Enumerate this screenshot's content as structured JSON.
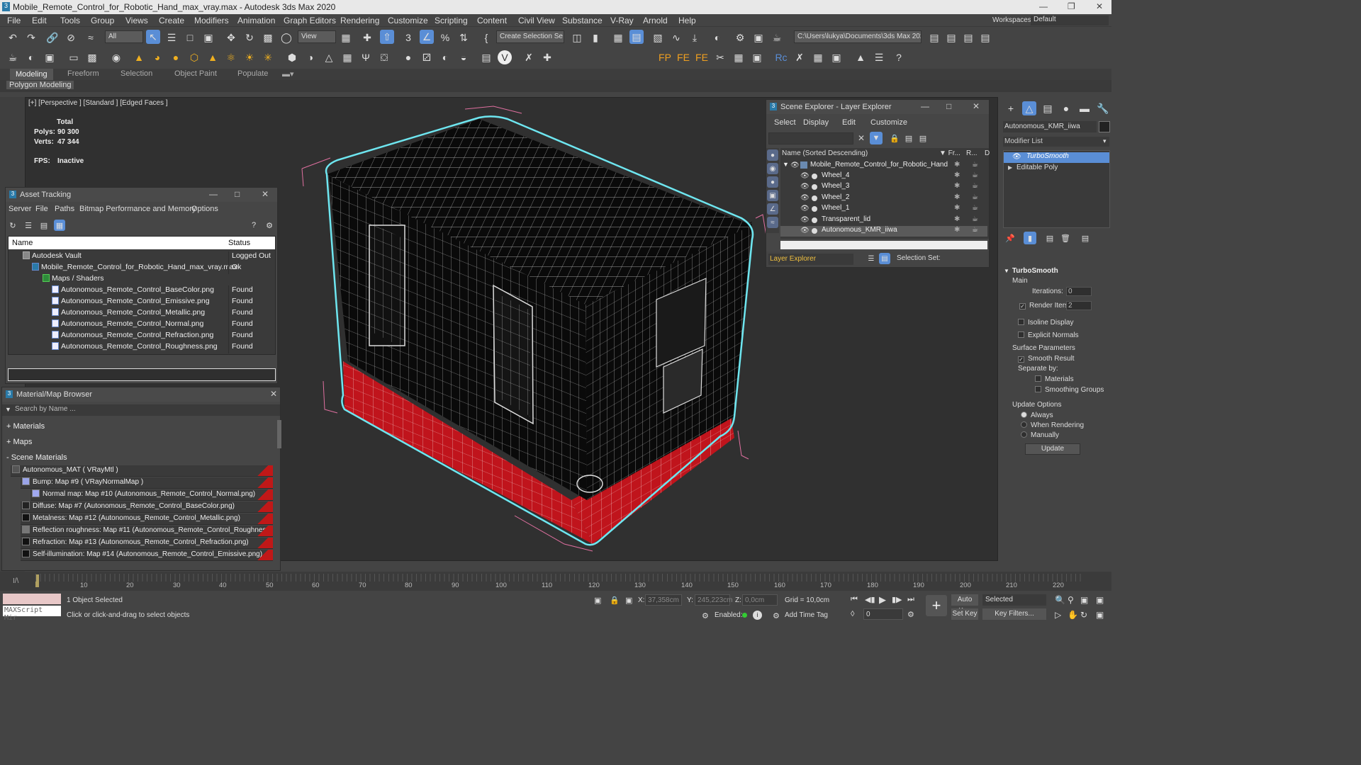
{
  "window": {
    "title": "Mobile_Remote_Control_for_Robotic_Hand_max_vray.max - Autodesk 3ds Max 2020"
  },
  "menu": [
    "File",
    "Edit",
    "Tools",
    "Group",
    "Views",
    "Create",
    "Modifiers",
    "Animation",
    "Graph Editors",
    "Rendering",
    "Customize",
    "Scripting",
    "Content",
    "Civil View",
    "Substance",
    "V-Ray",
    "Arnold",
    "Help"
  ],
  "workspace": {
    "label": "Workspaces:",
    "value": "Default"
  },
  "toolbar": {
    "filter": "All",
    "view": "View",
    "selection_set": "Create Selection Se",
    "path": "C:\\Users\\lukya\\Documents\\3ds Max 2022"
  },
  "ribbon": {
    "tabs": [
      "Modeling",
      "Freeform",
      "Selection",
      "Object Paint",
      "Populate"
    ],
    "sub": "Polygon Modeling"
  },
  "viewport": {
    "label": "[+] [Perspective ] [Standard ] [Edged Faces ]",
    "total": "Total",
    "polys_label": "Polys:",
    "polys": "90 300",
    "verts_label": "Verts:",
    "verts": "47 344",
    "fps_label": "FPS:",
    "fps": "Inactive"
  },
  "asset_tracking": {
    "title": "Asset Tracking",
    "menu": [
      "Server",
      "File",
      "Paths",
      "Bitmap Performance and Memory",
      "Options"
    ],
    "col_name": "Name",
    "col_status": "Status",
    "rows": [
      {
        "name": "Autodesk Vault",
        "status": "Logged Out ..."
      },
      {
        "name": "Mobile_Remote_Control_for_Robotic_Hand_max_vray.max",
        "status": "Ok"
      },
      {
        "name": "Maps / Shaders",
        "status": ""
      },
      {
        "name": "Autonomous_Remote_Control_BaseColor.png",
        "status": "Found"
      },
      {
        "name": "Autonomous_Remote_Control_Emissive.png",
        "status": "Found"
      },
      {
        "name": "Autonomous_Remote_Control_Metallic.png",
        "status": "Found"
      },
      {
        "name": "Autonomous_Remote_Control_Normal.png",
        "status": "Found"
      },
      {
        "name": "Autonomous_Remote_Control_Refraction.png",
        "status": "Found"
      },
      {
        "name": "Autonomous_Remote_Control_Roughness.png",
        "status": "Found"
      }
    ]
  },
  "material_browser": {
    "title": "Material/Map Browser",
    "search": "Search by Name ...",
    "sections": [
      "+ Materials",
      "+ Maps",
      "- Scene Materials"
    ],
    "items": [
      "Autonomous_MAT  ( VRayMtl )",
      "Bump: Map #9  ( VRayNormalMap )",
      "Normal map: Map #10 (Autonomous_Remote_Control_Normal.png)",
      "Diffuse: Map #7 (Autonomous_Remote_Control_BaseColor.png)",
      "Metalness: Map #12 (Autonomous_Remote_Control_Metallic.png)",
      "Reflection roughness: Map #11 (Autonomous_Remote_Control_Roughness.png)",
      "Refraction: Map #13 (Autonomous_Remote_Control_Refraction.png)",
      "Self-illumination: Map #14 (Autonomous_Remote_Control_Emissive.png)"
    ]
  },
  "scene_explorer": {
    "title": "Scene Explorer - Layer Explorer",
    "menu": [
      "Select",
      "Display",
      "Edit",
      "Customize"
    ],
    "col_name": "Name (Sorted Descending)",
    "col_fr": "▼ Fr...",
    "col_r": "R...",
    "col_d": "D",
    "root": "Mobile_Remote_Control_for_Robotic_Hand",
    "items": [
      "Wheel_4",
      "Wheel_3",
      "Wheel_2",
      "Wheel_1",
      "Transparent_lid",
      "Autonomous_KMR_iiwa"
    ],
    "footer_left": "Layer Explorer",
    "footer_right": "Selection Set:"
  },
  "command_panel": {
    "object_name": "Autonomous_KMR_iiwa",
    "modifier_list": "Modifier List",
    "stack": [
      "TurboSmooth",
      "Editable Poly"
    ],
    "rollout": "TurboSmooth",
    "main": "Main",
    "iterations_label": "Iterations:",
    "iterations": "0",
    "render_iters_label": "Render Iters:",
    "render_iters": "2",
    "isoline": "Isoline Display",
    "explicit": "Explicit Normals",
    "surface": "Surface Parameters",
    "smooth": "Smooth Result",
    "separate": "Separate by:",
    "materials": "Materials",
    "smoothing": "Smoothing Groups",
    "update_options": "Update Options",
    "always": "Always",
    "when_rendering": "When Rendering",
    "manually": "Manually",
    "update": "Update"
  },
  "timeline": {
    "ticks": [
      "10",
      "20",
      "30",
      "40",
      "50",
      "60",
      "70",
      "80",
      "90",
      "100",
      "110",
      "120",
      "130",
      "140",
      "150",
      "160",
      "170",
      "180",
      "190",
      "200",
      "210",
      "220"
    ],
    "frame_label": "0 / 100"
  },
  "status": {
    "selected": "1 Object Selected",
    "hint": "Click or click-and-drag to select objects",
    "maxscript": "MAXScript Mir",
    "x_label": "X:",
    "x": "37,358cm",
    "y_label": "Y:",
    "y": "245,223cm",
    "z_label": "Z:",
    "z": "0,0cm",
    "grid": "Grid = 10,0cm",
    "enabled": "Enabled:",
    "add_time_tag": "Add Time Tag",
    "auto_key": "Auto Key",
    "set_key": "Set Key",
    "selected_dd": "Selected",
    "key_filters": "Key Filters...",
    "frame": "0"
  },
  "colors": {
    "accent": "#5a8ed6",
    "selection_wire": "#6ee6f0",
    "base_red": "#c0141c"
  }
}
